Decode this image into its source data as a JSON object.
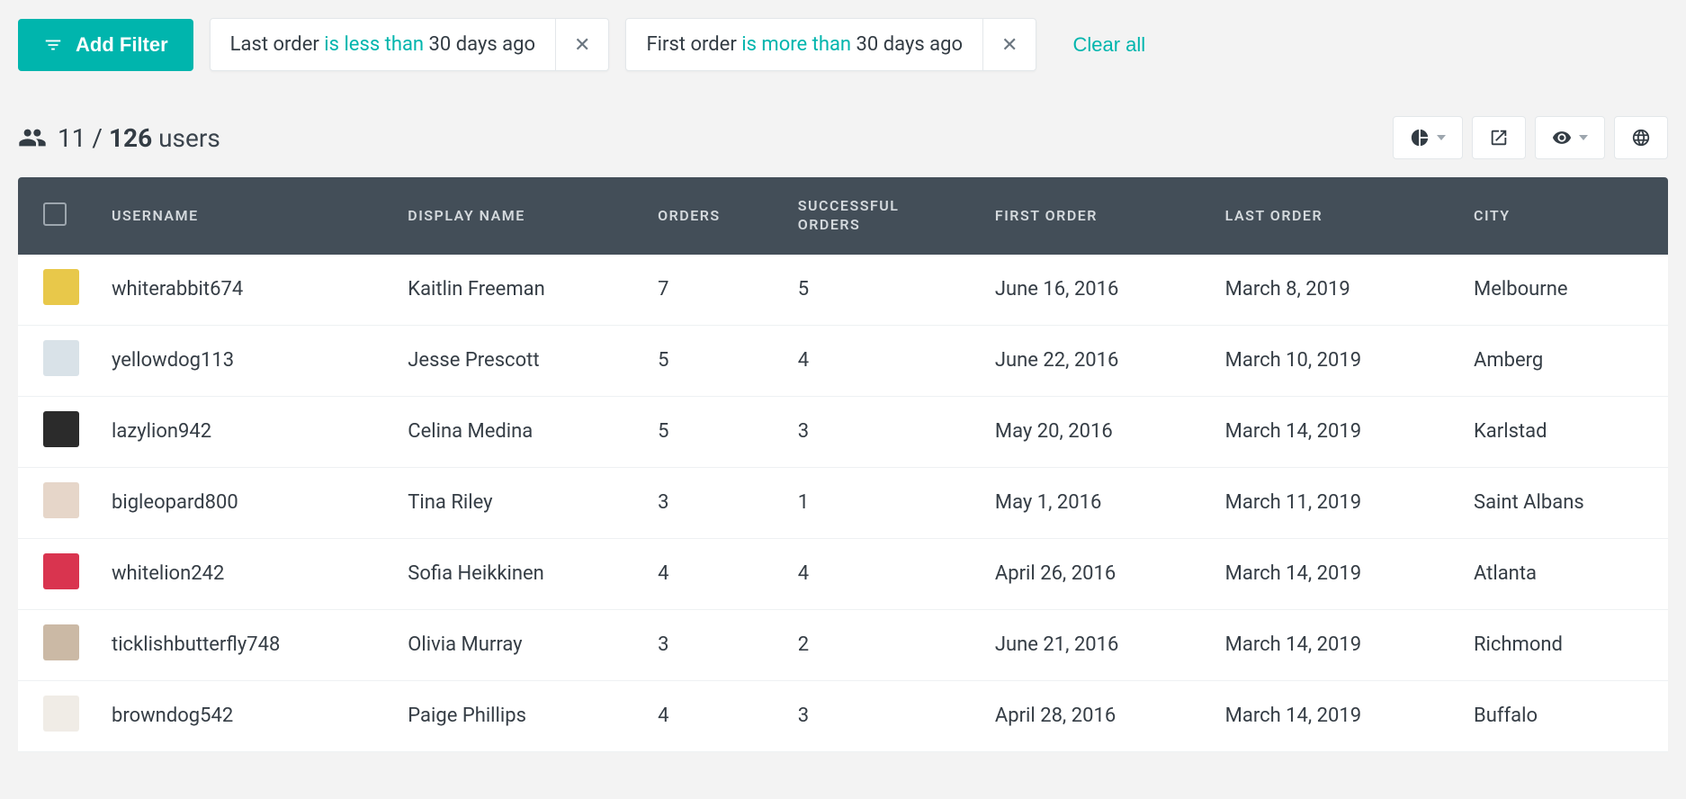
{
  "filter_bar": {
    "add_label": "Add Filter",
    "clear_all_label": "Clear all",
    "chips": [
      {
        "field": "Last order",
        "operator": "is less than",
        "value": "30 days ago"
      },
      {
        "field": "First order",
        "operator": "is more than",
        "value": "30 days ago"
      }
    ]
  },
  "count": {
    "shown": "11",
    "total": "126",
    "suffix": "users"
  },
  "table": {
    "headers": {
      "username": "USERNAME",
      "display_name": "DISPLAY NAME",
      "orders": "ORDERS",
      "successful_orders_l1": "SUCCESSFUL",
      "successful_orders_l2": "ORDERS",
      "first_order": "FIRST ORDER",
      "last_order": "LAST ORDER",
      "city": "CITY"
    },
    "rows": [
      {
        "avatar_bg": "#e8c84a",
        "username": "whiterabbit674",
        "display_name": "Kaitlin Freeman",
        "orders": "7",
        "successful_orders": "5",
        "first_order": "June 16, 2016",
        "last_order": "March 8, 2019",
        "city": "Melbourne"
      },
      {
        "avatar_bg": "#d9e2e8",
        "username": "yellowdog113",
        "display_name": "Jesse Prescott",
        "orders": "5",
        "successful_orders": "4",
        "first_order": "June 22, 2016",
        "last_order": "March 10, 2019",
        "city": "Amberg"
      },
      {
        "avatar_bg": "#2b2b2b",
        "username": "lazylion942",
        "display_name": "Celina Medina",
        "orders": "5",
        "successful_orders": "3",
        "first_order": "May 20, 2016",
        "last_order": "March 14, 2019",
        "city": "Karlstad"
      },
      {
        "avatar_bg": "#e6d6c9",
        "username": "bigleopard800",
        "display_name": "Tina Riley",
        "orders": "3",
        "successful_orders": "1",
        "first_order": "May 1, 2016",
        "last_order": "March 11, 2019",
        "city": "Saint Albans"
      },
      {
        "avatar_bg": "#d9344f",
        "username": "whitelion242",
        "display_name": "Sofia Heikkinen",
        "orders": "4",
        "successful_orders": "4",
        "first_order": "April 26, 2016",
        "last_order": "March 14, 2019",
        "city": "Atlanta"
      },
      {
        "avatar_bg": "#cbb9a5",
        "username": "ticklishbutterfly748",
        "display_name": "Olivia Murray",
        "orders": "3",
        "successful_orders": "2",
        "first_order": "June 21, 2016",
        "last_order": "March 14, 2019",
        "city": "Richmond"
      },
      {
        "avatar_bg": "#f0ece6",
        "username": "browndog542",
        "display_name": "Paige Phillips",
        "orders": "4",
        "successful_orders": "3",
        "first_order": "April 28, 2016",
        "last_order": "March 14, 2019",
        "city": "Buffalo"
      }
    ]
  }
}
